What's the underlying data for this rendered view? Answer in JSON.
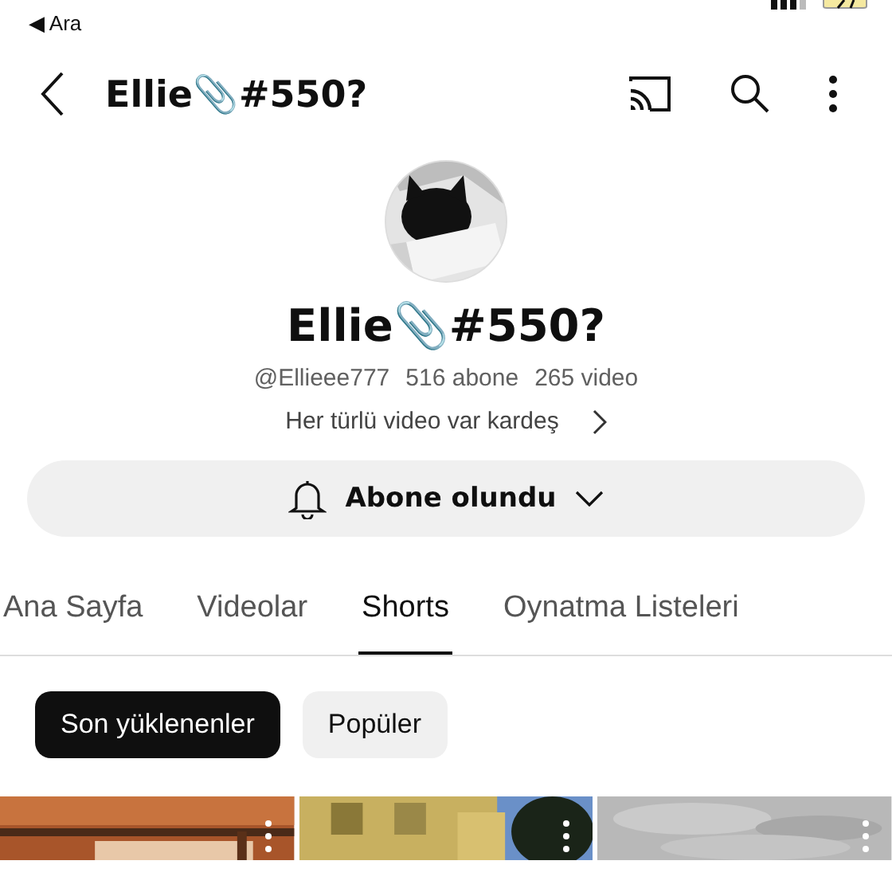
{
  "status_bar": {
    "back_label": "◀ Ara"
  },
  "header": {
    "title": "Ellie📎#550?"
  },
  "channel": {
    "name": "Ellie📎#550?",
    "handle": "@Ellieee777",
    "subscribers": "516 abone",
    "videos": "265 video",
    "description": "Her türlü video var kardeş"
  },
  "subscribe_button": {
    "label": "Abone olundu"
  },
  "tabs": [
    {
      "label": "Ana Sayfa",
      "selected": false
    },
    {
      "label": "Videolar",
      "selected": false
    },
    {
      "label": "Shorts",
      "selected": true
    },
    {
      "label": "Oynatma Listeleri",
      "selected": false
    }
  ],
  "chips": [
    {
      "label": "Son yüklenenler",
      "selected": true
    },
    {
      "label": "Popüler",
      "selected": false
    }
  ]
}
